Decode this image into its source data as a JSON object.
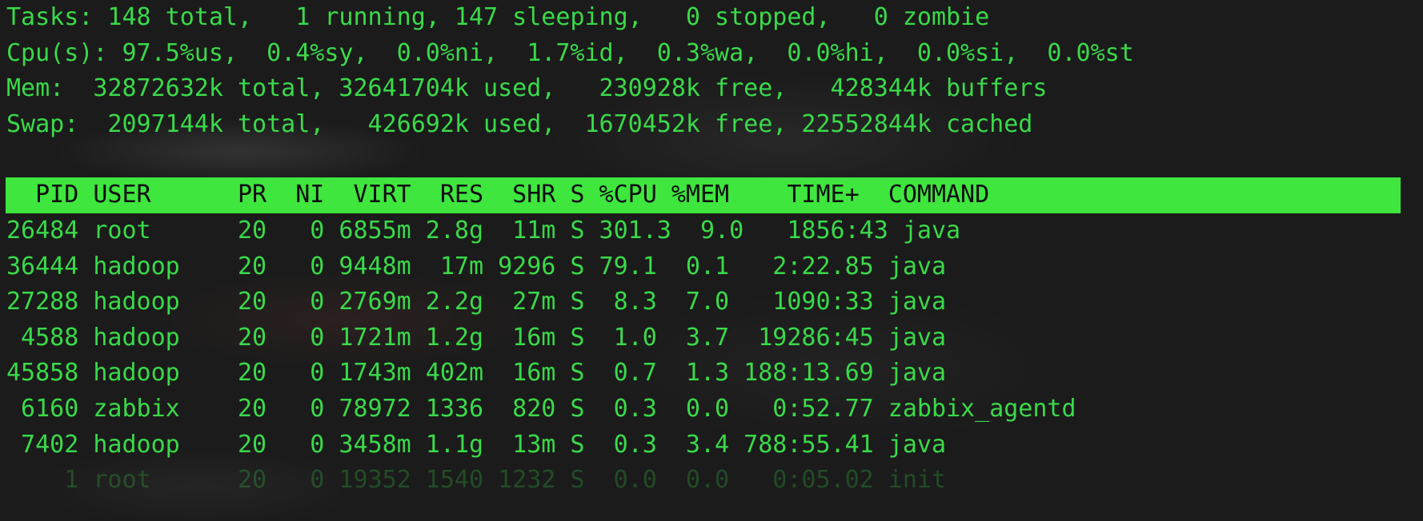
{
  "terminal": {
    "app": "top",
    "colors": {
      "background": "#1b1b1b",
      "foreground": "#3ad94a",
      "header_bar_background": "#3ee63e",
      "header_bar_foreground": "#0d0d0d"
    }
  },
  "summary": {
    "tasks": {
      "raw": "Tasks: 148 total,   1 running, 147 sleeping,   0 stopped,   0 zombie",
      "total": 148,
      "running": 1,
      "sleeping": 147,
      "stopped": 0,
      "zombie": 0
    },
    "cpu": {
      "raw": "Cpu(s): 97.5%us,  0.4%sy,  0.0%ni,  1.7%id,  0.3%wa,  0.0%hi,  0.0%si,  0.0%st",
      "us": "97.5",
      "sy": "0.4",
      "ni": "0.0",
      "id": "1.7",
      "wa": "0.3",
      "hi": "0.0",
      "si": "0.0",
      "st": "0.0"
    },
    "mem": {
      "raw": "Mem:  32872632k total, 32641704k used,   230928k free,   428344k buffers",
      "total": "32872632k",
      "used": "32641704k",
      "free": "230928k",
      "buffers": "428344k"
    },
    "swap": {
      "raw": "Swap:  2097144k total,   426692k used,  1670452k free, 22552844k cached",
      "total": "2097144k",
      "used": "426692k",
      "free": "1670452k",
      "cached": "22552844k"
    }
  },
  "table": {
    "header_raw": "  PID USER      PR  NI  VIRT  RES  SHR S %CPU %MEM    TIME+  COMMAND",
    "columns": [
      "PID",
      "USER",
      "PR",
      "NI",
      "VIRT",
      "RES",
      "SHR",
      "S",
      "%CPU",
      "%MEM",
      "TIME+",
      "COMMAND"
    ],
    "rows": [
      {
        "raw": "26484 root      20   0 6855m 2.8g  11m S 301.3  9.0   1856:43 java",
        "pid": "26484",
        "user": "root",
        "pr": "20",
        "ni": "0",
        "virt": "6855m",
        "res": "2.8g",
        "shr": "11m",
        "s": "S",
        "cpu": "301.3",
        "mem": "9.0",
        "time": "1856:43",
        "command": "java"
      },
      {
        "raw": "36444 hadoop    20   0 9448m  17m 9296 S 79.1  0.1   2:22.85 java",
        "pid": "36444",
        "user": "hadoop",
        "pr": "20",
        "ni": "0",
        "virt": "9448m",
        "res": "17m",
        "shr": "9296",
        "s": "S",
        "cpu": "79.1",
        "mem": "0.1",
        "time": "2:22.85",
        "command": "java"
      },
      {
        "raw": "27288 hadoop    20   0 2769m 2.2g  27m S  8.3  7.0   1090:33 java",
        "pid": "27288",
        "user": "hadoop",
        "pr": "20",
        "ni": "0",
        "virt": "2769m",
        "res": "2.2g",
        "shr": "27m",
        "s": "S",
        "cpu": "8.3",
        "mem": "7.0",
        "time": "1090:33",
        "command": "java"
      },
      {
        "raw": " 4588 hadoop    20   0 1721m 1.2g  16m S  1.0  3.7  19286:45 java",
        "pid": "4588",
        "user": "hadoop",
        "pr": "20",
        "ni": "0",
        "virt": "1721m",
        "res": "1.2g",
        "shr": "16m",
        "s": "S",
        "cpu": "1.0",
        "mem": "3.7",
        "time": "19286:45",
        "command": "java"
      },
      {
        "raw": "45858 hadoop    20   0 1743m 402m  16m S  0.7  1.3 188:13.69 java",
        "pid": "45858",
        "user": "hadoop",
        "pr": "20",
        "ni": "0",
        "virt": "1743m",
        "res": "402m",
        "shr": "16m",
        "s": "S",
        "cpu": "0.7",
        "mem": "1.3",
        "time": "188:13.69",
        "command": "java"
      },
      {
        "raw": " 6160 zabbix    20   0 78972 1336  820 S  0.3  0.0   0:52.77 zabbix_agentd",
        "pid": "6160",
        "user": "zabbix",
        "pr": "20",
        "ni": "0",
        "virt": "78972",
        "res": "1336",
        "shr": "820",
        "s": "S",
        "cpu": "0.3",
        "mem": "0.0",
        "time": "0:52.77",
        "command": "zabbix_agentd"
      },
      {
        "raw": " 7402 hadoop    20   0 3458m 1.1g  13m S  0.3  3.4 788:55.41 java",
        "pid": "7402",
        "user": "hadoop",
        "pr": "20",
        "ni": "0",
        "virt": "3458m",
        "res": "1.1g",
        "shr": "13m",
        "s": "S",
        "cpu": "0.3",
        "mem": "3.4",
        "time": "788:55.41",
        "command": "java"
      },
      {
        "raw": "    1 root      20   0 19352 1540 1232 S  0.0  0.0   0:05.02 init",
        "pid": "1",
        "user": "root",
        "pr": "20",
        "ni": "0",
        "virt": "19352",
        "res": "1540",
        "shr": "1232",
        "s": "S",
        "cpu": "0.0",
        "mem": "0.0",
        "time": "0:05.02",
        "command": "init"
      }
    ]
  }
}
